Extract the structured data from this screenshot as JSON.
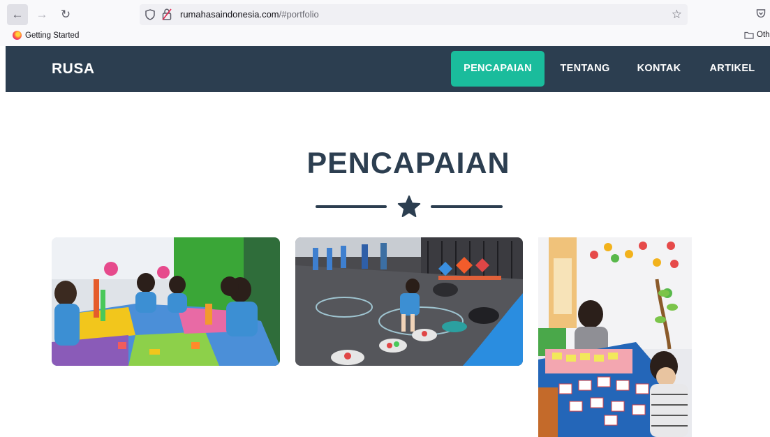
{
  "browser": {
    "url_domain": "rumahasaindonesia.com",
    "url_path": "/#portfolio",
    "bookmark": "Getting Started",
    "other_bookmarks": "Oth"
  },
  "nav": {
    "brand": "RUSA",
    "links": [
      "PENCAPAIAN",
      "TENTANG",
      "KONTAK",
      "ARTIKEL"
    ],
    "active_index": 0
  },
  "section": {
    "title": "PENCAPAIAN"
  },
  "colors": {
    "navbar_bg": "#2c3e50",
    "accent": "#1abc9c",
    "heading": "#2c3e50"
  },
  "portfolio": {
    "items": [
      {
        "icon": "photo-children-playing-blocks"
      },
      {
        "icon": "photo-children-playground"
      },
      {
        "icon": "photo-children-card-game"
      }
    ]
  }
}
